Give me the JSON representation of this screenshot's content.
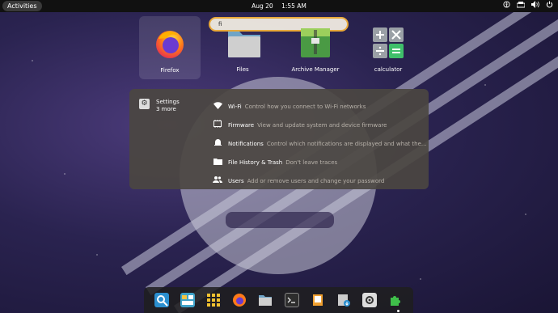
{
  "topbar": {
    "activities": "Activities",
    "date": "Aug 20",
    "time": "1:55 AM",
    "tray_icons": [
      "accessibility-icon",
      "network-icon",
      "volume-icon",
      "power-icon"
    ]
  },
  "search": {
    "value": "fi"
  },
  "apps": [
    {
      "label": "Firefox",
      "icon": "firefox-icon",
      "selected": true
    },
    {
      "label": "Files",
      "icon": "folder-icon"
    },
    {
      "label": "Archive Manager",
      "icon": "archive-icon"
    },
    {
      "label": "calculator",
      "icon": "calculator-icon"
    }
  ],
  "settings": {
    "title": "Settings",
    "subtitle": "3 more",
    "results": [
      {
        "icon": "wifi-icon",
        "title": "Wi-Fi",
        "desc": "Control how you connect to Wi-Fi networks"
      },
      {
        "icon": "chip-icon",
        "title": "Firmware",
        "desc": "View and update system and device firmware"
      },
      {
        "icon": "bell-icon",
        "title": "Notifications",
        "desc": "Control which notifications are displayed and what the..."
      },
      {
        "icon": "folder-icon",
        "title": "File History & Trash",
        "desc": "Don't leave traces"
      },
      {
        "icon": "users-icon",
        "title": "Users",
        "desc": "Add or remove users and change your password"
      }
    ]
  },
  "dock": [
    "screenshot-tool-icon",
    "window-manager-icon",
    "app-grid-icon",
    "firefox-icon",
    "files-icon",
    "terminal-icon",
    "notes-icon",
    "installer-icon",
    "settings-icon",
    "extensions-icon"
  ]
}
